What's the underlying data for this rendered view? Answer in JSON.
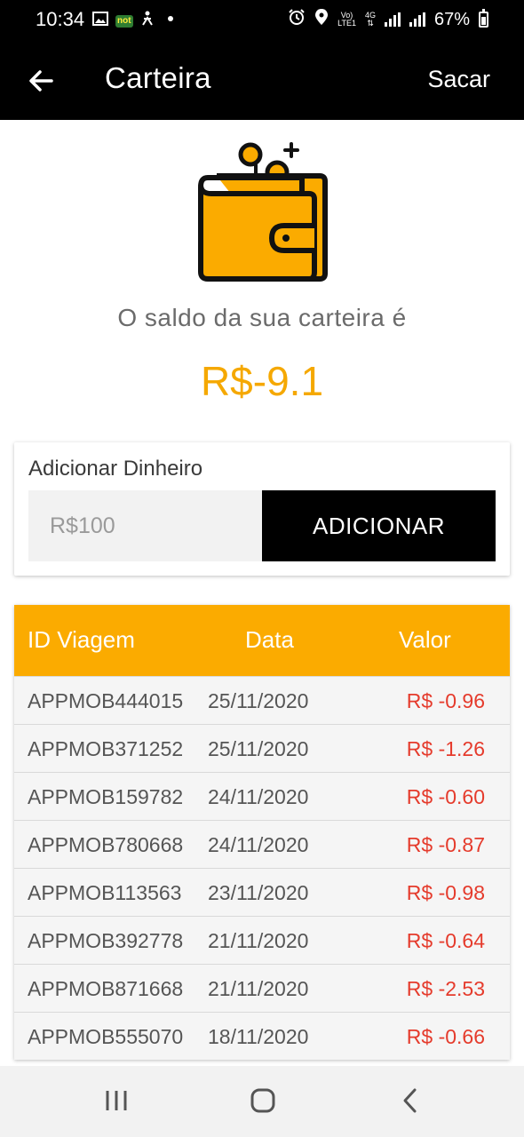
{
  "status_bar": {
    "time": "10:34",
    "volte_top": "Vo)",
    "volte_bottom": "LTE1",
    "network_type": "4G",
    "battery": "67%",
    "notification_badge": "not"
  },
  "app_bar": {
    "title": "Carteira",
    "action": "Sacar"
  },
  "wallet": {
    "balance_label": "O saldo da sua carteira é",
    "balance_value": "R$-9.1",
    "icon": "wallet-icon"
  },
  "add_money": {
    "title": "Adicionar Dinheiro",
    "input_placeholder": "R$100",
    "button_label": "ADICIONAR"
  },
  "transactions": {
    "headers": [
      "ID Viagem",
      "Data",
      "Valor"
    ],
    "rows": [
      {
        "id": "APPMOB444015",
        "date": "25/11/2020",
        "value": "R$ -0.96"
      },
      {
        "id": "APPMOB371252",
        "date": "25/11/2020",
        "value": "R$ -1.26"
      },
      {
        "id": "APPMOB159782",
        "date": "24/11/2020",
        "value": "R$ -0.60"
      },
      {
        "id": "APPMOB780668",
        "date": "24/11/2020",
        "value": "R$ -0.87"
      },
      {
        "id": "APPMOB113563",
        "date": "23/11/2020",
        "value": "R$ -0.98"
      },
      {
        "id": "APPMOB392778",
        "date": "21/11/2020",
        "value": "R$ -0.64"
      },
      {
        "id": "APPMOB871668",
        "date": "21/11/2020",
        "value": "R$ -2.53"
      },
      {
        "id": "APPMOB555070",
        "date": "18/11/2020",
        "value": "R$ -0.66"
      }
    ]
  },
  "colors": {
    "accent": "#f5a800",
    "header_bg": "#fbab00",
    "negative_value": "#e53b2c",
    "app_bar_bg": "#000000"
  },
  "navigation": [
    "recent-apps-icon",
    "home-icon",
    "back-nav-icon"
  ]
}
